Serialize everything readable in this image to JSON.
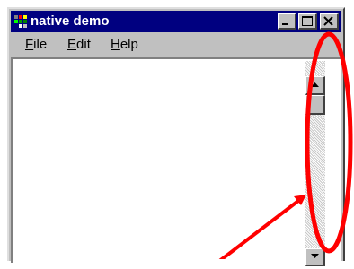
{
  "window": {
    "title": "native demo",
    "controls": [
      "minimize",
      "maximize",
      "close"
    ]
  },
  "menu": {
    "items": [
      {
        "mnemonic": "F",
        "rest": "ile"
      },
      {
        "mnemonic": "E",
        "rest": "dit"
      },
      {
        "mnemonic": "H",
        "rest": "elp"
      }
    ]
  },
  "annotation": {
    "color": "#ff0000",
    "shapes": [
      "ellipse",
      "arrow"
    ]
  },
  "colors": {
    "titlebar": "#000080",
    "face": "#c0c0c0",
    "client": "#ffffff"
  }
}
